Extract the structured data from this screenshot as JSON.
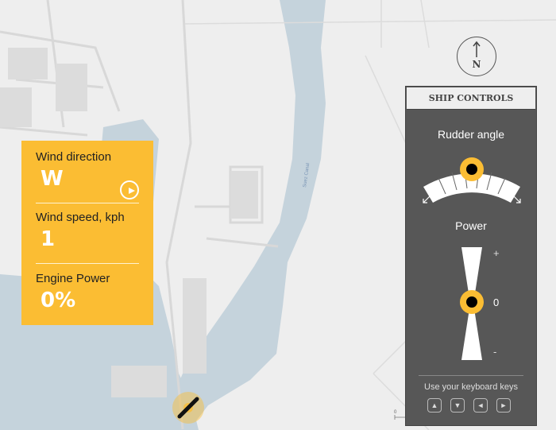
{
  "map": {
    "canal_label": "Suez Canal",
    "scale_label": "0",
    "water_color": "#c5d3dc",
    "land_color": "#eeeeee"
  },
  "info": {
    "wind_direction_label": "Wind direction",
    "wind_direction_value": "W",
    "wind_speed_label": "Wind speed, kph",
    "wind_speed_value": "1",
    "engine_power_label": "Engine Power",
    "engine_power_value": "0%",
    "accent": "#fbbd33"
  },
  "compass": {
    "label": "N"
  },
  "controls": {
    "title": "SHIP CONTROLS",
    "rudder_label": "Rudder angle",
    "power_label": "Power",
    "power_plus": "+",
    "power_value": "0",
    "power_minus": "-",
    "hint": "Use your keyboard keys",
    "keys": [
      "▲",
      "▼",
      "◄",
      "►"
    ]
  }
}
